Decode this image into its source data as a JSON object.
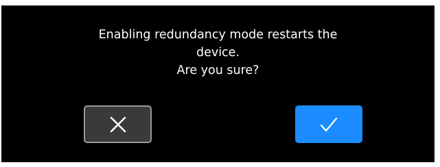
{
  "dialog": {
    "message_lines": [
      "Enabling redundancy mode restarts the",
      "device.",
      "Are you sure?"
    ]
  },
  "buttons": {
    "cancel": {
      "icon": "close-icon",
      "color": "#3a3a3a"
    },
    "confirm": {
      "icon": "check-icon",
      "color": "#1a8cff"
    }
  }
}
